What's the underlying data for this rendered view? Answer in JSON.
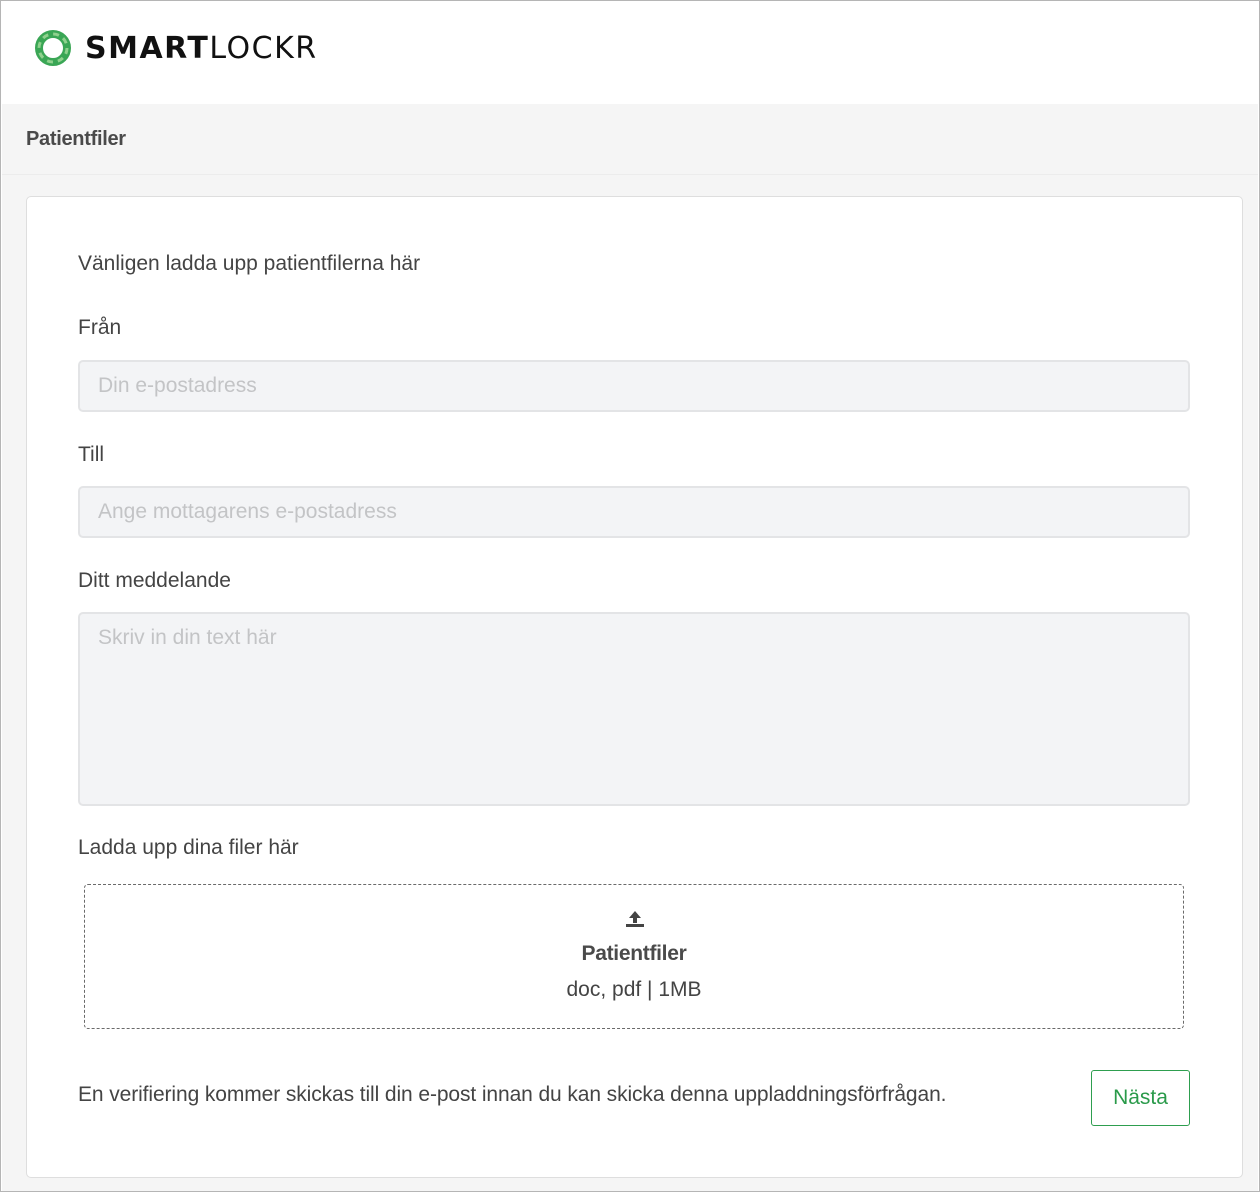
{
  "brand": {
    "name_bold": "SMART",
    "name_light": "LOCKR",
    "icon": "smartlockr-logo-icon",
    "accent_color": "#2a9a4a"
  },
  "header": {
    "title": "Patientfiler"
  },
  "form": {
    "intro": "Vänligen ladda upp patientfilerna här",
    "from": {
      "label": "Från",
      "value": "",
      "placeholder": "Din e-postadress"
    },
    "to": {
      "label": "Till",
      "value": "",
      "placeholder": "Ange mottagarens e-postadress"
    },
    "message": {
      "label": "Ditt meddelande",
      "value": "",
      "placeholder": "Skriv in din text här"
    },
    "upload": {
      "label": "Ladda upp dina filer här",
      "icon": "upload-icon",
      "title": "Patientfiler",
      "constraints": "doc, pdf | 1MB"
    },
    "footnote": "En verifiering kommer skickas till din e-post innan du kan skicka denna uppladdningsförfrågan.",
    "next_label": "Nästa"
  }
}
